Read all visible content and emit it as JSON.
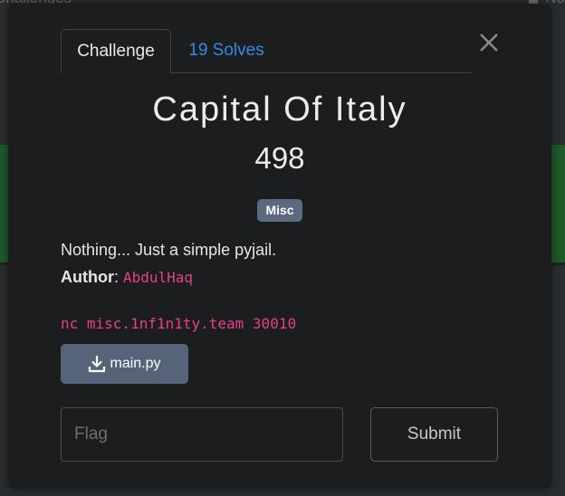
{
  "background": {
    "title": "Challenges",
    "right_text": "No"
  },
  "tabs": [
    {
      "label": "Challenge"
    },
    {
      "label": "19 Solves"
    }
  ],
  "challenge": {
    "name": "Capital Of Italy",
    "value": "498",
    "category": "Misc",
    "description": "Nothing... Just a simple pyjail.",
    "author_label": "Author",
    "author_name": "AbdulHaq",
    "connection": "nc misc.1nf1n1ty.team 30010",
    "file_name": "main.py"
  },
  "form": {
    "flag_placeholder": "Flag",
    "submit_label": "Submit"
  },
  "colors": {
    "accent": "#2f8de4",
    "code": "#e83e8c",
    "badge": "#5c6a80",
    "button": "#56647a"
  },
  "icons": {
    "close": "close-icon",
    "download": "download-icon"
  }
}
